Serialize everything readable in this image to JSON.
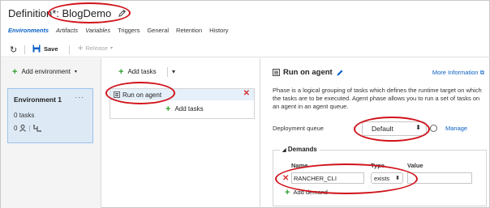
{
  "title": {
    "prefix": "Definition",
    "changed_marker": "*: ",
    "name": "BlogDemo"
  },
  "tabs": [
    {
      "label": "Environments",
      "active": true
    },
    {
      "label": "Artifacts"
    },
    {
      "label": "Variables"
    },
    {
      "label": "Triggers"
    },
    {
      "label": "General"
    },
    {
      "label": "Retention"
    },
    {
      "label": "History"
    }
  ],
  "toolbar": {
    "save_label": "Save",
    "release_label": "Release"
  },
  "environments": {
    "add_label": "Add environment",
    "card": {
      "name": "Environment 1",
      "tasks": "0 tasks",
      "approvers": "0"
    }
  },
  "tasks": {
    "add_label": "Add tasks",
    "phase_label": "Run on agent",
    "phase_add_label": "Add tasks"
  },
  "details": {
    "title": "Run on agent",
    "more_info": "More Information",
    "description": "Phase is a logical grouping of tasks which defines the runtime target on which the tasks are to be executed. Agent phase allows you to run a set of tasks on an agent in an agent queue.",
    "deployment_queue_label": "Deployment queue",
    "deployment_queue_value": "Default",
    "manage_label": "Manage"
  },
  "demands": {
    "section_title": "Demands",
    "col_name": "Name",
    "col_type": "Type",
    "col_value": "Value",
    "rows": [
      {
        "name": "RANCHER_CLI",
        "type": "exists",
        "value": ""
      }
    ],
    "add_label": "Add demand"
  },
  "colors": {
    "accent": "#0a60c4",
    "highlight": "#d0131a",
    "add_green": "#2d9e2d",
    "delete_red": "#d63131"
  }
}
